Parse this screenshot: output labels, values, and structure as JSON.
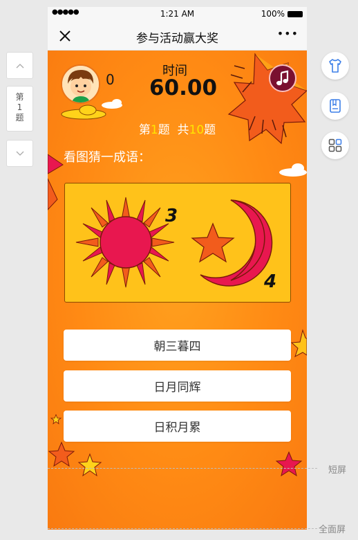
{
  "status_bar": {
    "signal": "●●●●●",
    "time": "1:21 AM",
    "battery": "100%"
  },
  "nav": {
    "title": "参与活动赢大奖",
    "more": "•••"
  },
  "side": {
    "page_line1": "第",
    "page_line2": "1",
    "page_line3": "题"
  },
  "game": {
    "score": "0",
    "timer_label": "时间",
    "timer_value": "60.00",
    "progress_prefix": "第",
    "progress_current": "1",
    "progress_mid": "题  共",
    "progress_total": "10",
    "progress_suffix": "题",
    "question": "看图猜一成语：",
    "clue_number_left": "3",
    "clue_number_right": "4",
    "options": [
      "朝三暮四",
      "日月同辉",
      "日积月累"
    ]
  },
  "hints": {
    "short_screen": "短屏",
    "full_screen": "全面屏"
  },
  "colors": {
    "accent": "#ff8a14",
    "highlight": "#ffe600",
    "puzzle_bg": "#ffc21a",
    "sun": "#e8174f"
  }
}
